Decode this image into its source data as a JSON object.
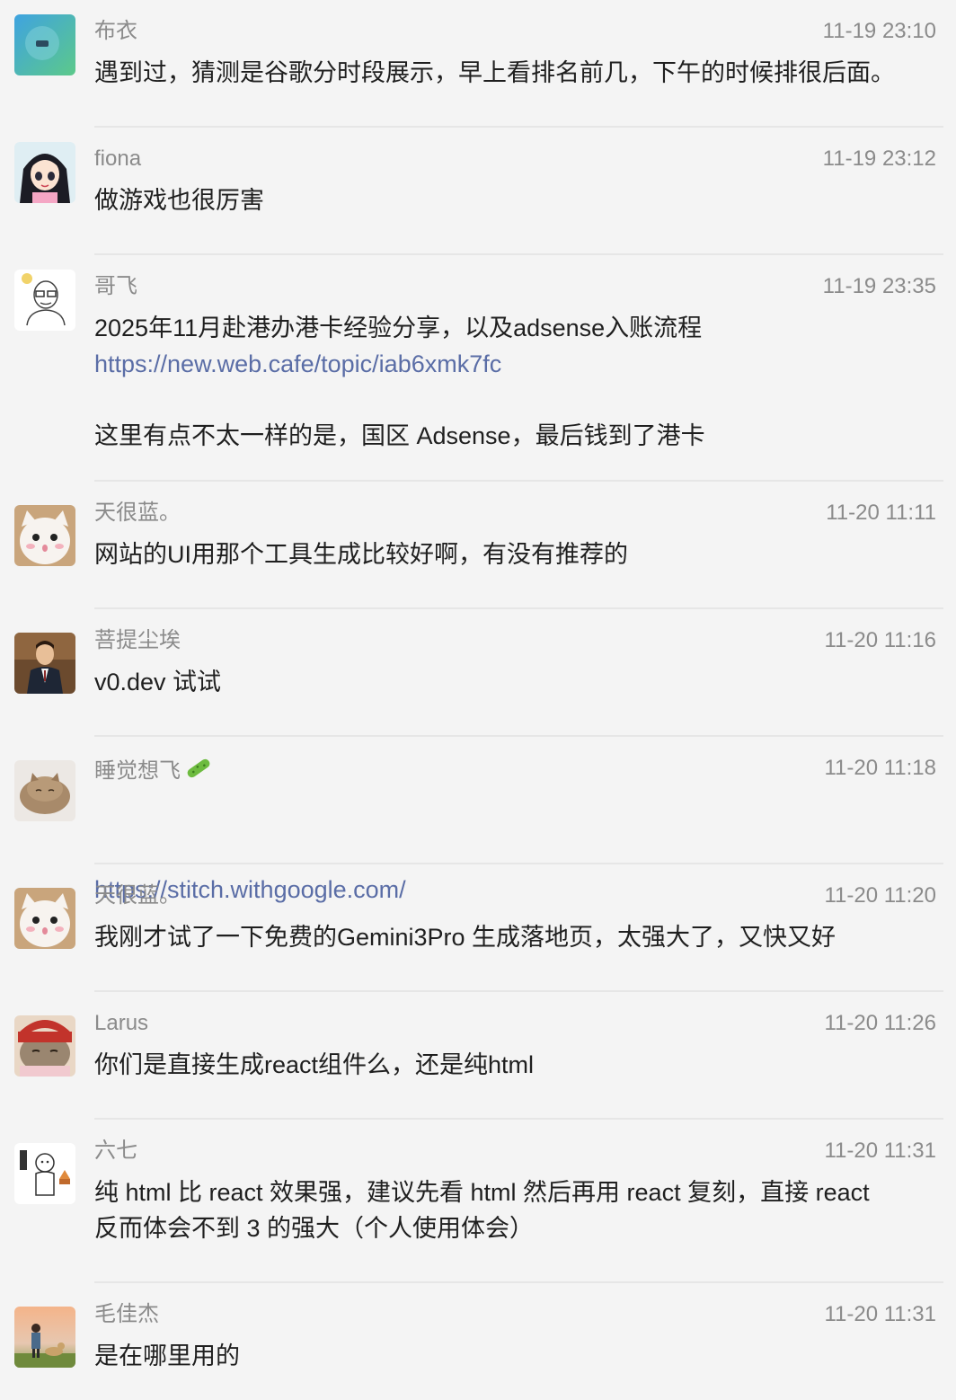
{
  "messages": [
    {
      "name": "布衣",
      "time": "11-19 23:10",
      "text": "遇到过，猜测是谷歌分时段展示，早上看排名前几，下午的时候排很后面。",
      "avatar": "gradient-app-icon"
    },
    {
      "name": "fiona",
      "time": "11-19 23:12",
      "text": "做游戏也很厉害",
      "avatar": "anime-girl-avatar"
    },
    {
      "name": "哥飞",
      "time": "11-19 23:35",
      "line1": "2025年11月赴港办港卡经验分享，以及adsense入账流程",
      "link": "https://new.web.cafe/topic/iab6xmk7fc",
      "line2": "这里有点不太一样的是，国区 Adsense，最后钱到了港卡",
      "avatar": "glasses-man-sketch-avatar"
    },
    {
      "name": "天很蓝。",
      "time": "11-20 11:11",
      "text": "网站的UI用那个工具生成比较好啊，有没有推荐的",
      "avatar": "white-cat-avatar"
    },
    {
      "name": "菩提尘埃",
      "time": "11-20 11:16",
      "text": "v0.dev 试试",
      "avatar": "man-in-suit-avatar"
    },
    {
      "name": "睡觉想飞",
      "name_emoji": "cucumber-icon",
      "time": "11-20 11:18",
      "link": "https://stitch.withgoogle.com/",
      "avatar": "loaf-cat-avatar"
    },
    {
      "name": "天很蓝。",
      "time": "11-20 11:20",
      "text": "我刚才试了一下免费的Gemini3Pro 生成落地页，太强大了，又快又好",
      "avatar": "white-cat-avatar"
    },
    {
      "name": "Larus",
      "time": "11-20 11:26",
      "text": "你们是直接生成react组件么，还是纯html",
      "avatar": "cat-in-red-hat-avatar"
    },
    {
      "name": "六七",
      "time": "11-20 11:31",
      "text": "纯 html 比 react 效果强，建议先看 html 然后再用 react 复刻，直接 react\n反而体会不到 3 的强大（个人使用体会）",
      "avatar": "doodle-sticker-avatar"
    },
    {
      "name": "毛佳杰",
      "time": "11-20 11:31",
      "text": "是在哪里用的",
      "avatar": "boy-and-dog-sunset-avatar"
    }
  ]
}
